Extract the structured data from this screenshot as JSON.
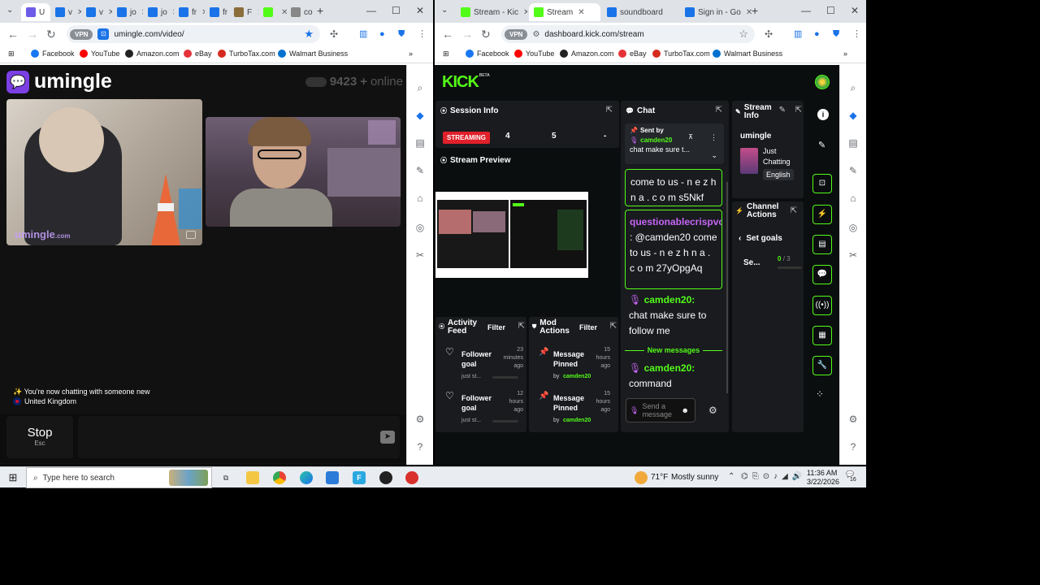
{
  "left_browser": {
    "tabs": [
      {
        "label": "U",
        "icon_color": "#6c5ce7",
        "active": true
      },
      {
        "label": "v",
        "icon_color": "#1a73e8"
      },
      {
        "label": "v",
        "icon_color": "#1a73e8"
      },
      {
        "label": "jo",
        "icon_color": "#1a73e8"
      },
      {
        "label": "jo",
        "icon_color": "#1a73e8"
      },
      {
        "label": "fr",
        "icon_color": "#1a73e8"
      },
      {
        "label": "fr",
        "icon_color": "#1a73e8"
      },
      {
        "label": "F",
        "icon_color": "#8a6d3b"
      },
      {
        "label": "",
        "icon_color": "#53fc18"
      },
      {
        "label": "co",
        "icon_color": "#888888"
      }
    ],
    "url": "umingle.com/video/",
    "vpn_label": "VPN"
  },
  "right_browser": {
    "tabs": [
      {
        "label": "Stream - Kic",
        "icon_color": "#53fc18"
      },
      {
        "label": "Stream",
        "icon_color": "#53fc18",
        "active": true
      },
      {
        "label": "soundboard",
        "icon_color": "#1a73e8"
      },
      {
        "label": "Sign in - Go",
        "icon_color": "#1a73e8"
      }
    ],
    "url": "dashboard.kick.com/stream",
    "vpn_label": "VPN"
  },
  "bookmarks": [
    {
      "label": "Facebook",
      "color": "#1877f2"
    },
    {
      "label": "YouTube",
      "color": "#ff0000"
    },
    {
      "label": "Amazon.com",
      "color": "#222222"
    },
    {
      "label": "eBay",
      "color": "#e53238"
    },
    {
      "label": "TurboTax.com",
      "color": "#d52b1e"
    },
    {
      "label": "Walmart Business",
      "color": "#0071ce"
    }
  ],
  "umingle": {
    "logo": "umingle",
    "logo_glyph": "💬",
    "online_count": "9423",
    "online_plus": "+",
    "online_label": "online",
    "watermark": "umingle",
    "watermark_suffix": ".com",
    "status_line": "You're now chatting with someone new",
    "status_sparkle": "✨",
    "country": "United Kingdom",
    "stop_label": "Stop",
    "stop_key": "Esc"
  },
  "kick": {
    "logo": "KICK",
    "logo_beta": "BETA",
    "session_info": {
      "title": "Session Info",
      "status": "STREAMING",
      "stat_1": "4",
      "stat_2": "5",
      "stat_3": "-"
    },
    "preview_title": "Stream Preview",
    "chat": {
      "title": "Chat",
      "pinned_label": "Sent by",
      "pinned_user": "camden20",
      "pinned_text": "chat make sure t...",
      "messages": [
        {
          "text": "come to us - n e z h n a . c o m s5Nkf"
        },
        {
          "user": "questionablecrispvo",
          "text": ": @camden20 come to us - n e z h n a . c o m 27yOpgAq"
        },
        {
          "user": "camden20",
          "text": "chat make sure to follow me"
        }
      ],
      "new_messages": "New messages",
      "last_user": "camden20",
      "last_text": "command",
      "input_placeholder": "Send a message"
    },
    "stream_info": {
      "title": "Stream Info",
      "channel": "umingle",
      "category": "Just Chatting",
      "language": "English"
    },
    "channel_actions": {
      "title": "Channel Actions",
      "set_goals": "Set goals",
      "row_label": "Se...",
      "progress_value": "0",
      "progress_total": "/ 3"
    },
    "activity_feed": {
      "title": "Activity Feed",
      "filter": "Filter",
      "items": [
        {
          "title": "Follower goal",
          "time": "23 minutes ago",
          "sub": "just st..."
        },
        {
          "title": "Follower goal",
          "time": "12 hours ago",
          "sub": "just st..."
        }
      ]
    },
    "mod_actions": {
      "title": "Mod Actions",
      "filter": "Filter",
      "items": [
        {
          "title": "Message Pinned",
          "time": "15 hours ago",
          "by": "by",
          "user": "camden20"
        },
        {
          "title": "Message Pinned",
          "time": "15 hours ago",
          "by": "by",
          "user": "camden20"
        }
      ]
    }
  },
  "taskbar": {
    "search_placeholder": "Type here to search",
    "weather_temp": "71°F",
    "weather_desc": "Mostly sunny",
    "time": "11:36 AM",
    "date": "3/22/2026",
    "notif_count": "16"
  },
  "colors": {
    "kick_green": "#53fc18",
    "umingle_purple": "#7b3fe4",
    "streaming_red": "#e0202a"
  }
}
